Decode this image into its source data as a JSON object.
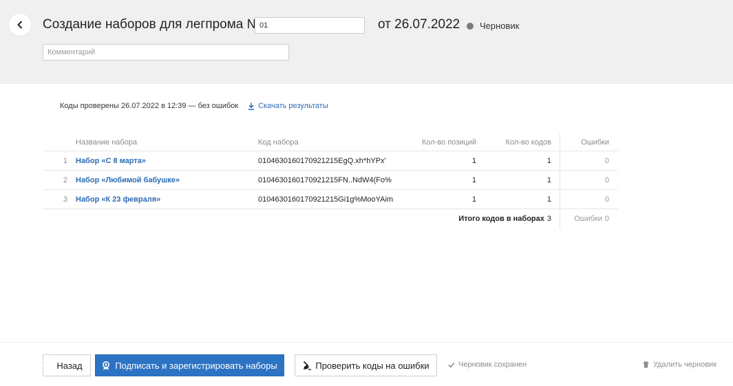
{
  "header": {
    "title": "Создание наборов для легпрома №",
    "number_value": "01",
    "date_text": "от 26.07.2022",
    "status_label": "Черновик",
    "status_color": "#7a7a7a",
    "comment_placeholder": "Комментарий",
    "comment_value": ""
  },
  "check_result": {
    "text": "Коды проверены 26.07.2022 в 12:39 — без ошибок",
    "download_label": "Скачать результаты"
  },
  "table": {
    "columns": [
      "Название набора",
      "Код набора",
      "Кол-во позиций",
      "Кол-во кодов",
      "Ошибки"
    ],
    "rows": [
      {
        "num": "1",
        "name": "Набор «С 8 марта»",
        "code": "0104630160170921215EgQ.xh*hYPx'",
        "positions": "1",
        "codes": "1",
        "errors": "0"
      },
      {
        "num": "2",
        "name": "Набор «Любимой бабушке»",
        "code": "0104630160170921215FN..NdW4(Fo%",
        "positions": "1",
        "codes": "1",
        "errors": "0"
      },
      {
        "num": "3",
        "name": "Набор «К 23 февраля»",
        "code": "0104630160170921215Gi1g%MooYAim",
        "positions": "1",
        "codes": "1",
        "errors": "0"
      }
    ],
    "total_label": "Итого кодов в наборах",
    "total_value": "3",
    "total_errors_label": "Ошибки",
    "total_errors_value": "0"
  },
  "footer": {
    "back_label": "Назад",
    "sign_label": "Подписать и зарегистрировать наборы",
    "check_label": "Проверить коды на ошибки",
    "saved_label": "Черновик сохранен",
    "delete_label": "Удалить черновик"
  },
  "colors": {
    "accent": "#2d73c4",
    "link": "#2d6bb4",
    "header_bg": "#f0f0f0"
  }
}
